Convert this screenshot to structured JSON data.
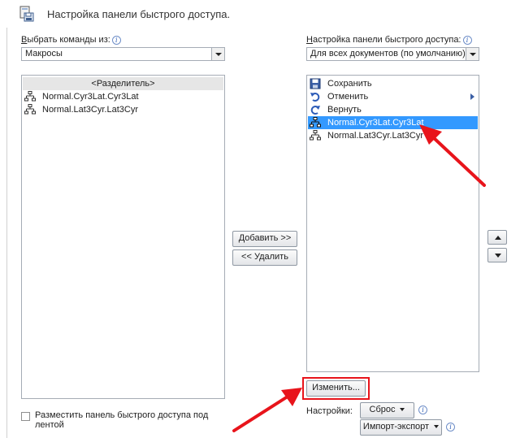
{
  "header": {
    "title": "Настройка панели быстрого доступа."
  },
  "left": {
    "choose_label_ul": "В",
    "choose_label_rest": "ыбрать команды из:",
    "commands_combo_value": "Макросы",
    "items": [
      {
        "label": "<Разделитель>",
        "kind": "separator"
      },
      {
        "label": "Normal.Cyr3Lat.Cyr3Lat",
        "icon": "macro-icon"
      },
      {
        "label": "Normal.Lat3Cyr.Lat3Cyr",
        "icon": "macro-icon"
      }
    ],
    "place_below_checkbox_label_line1": "Разместить панель быстрого доступа под",
    "place_below_checkbox_label_line2": "лентой"
  },
  "middle": {
    "add_button": "Добавить >>",
    "remove_button": "<< Удалить"
  },
  "right": {
    "customize_label_ul": "Н",
    "customize_label_rest": "астройка панели быстрого доступа:",
    "scope_combo_value": "Для всех документов (по умолчанию)",
    "items": [
      {
        "label": "Сохранить",
        "icon": "save-icon"
      },
      {
        "label": "Отменить",
        "icon": "undo-icon"
      },
      {
        "label": "Вернуть",
        "icon": "redo-icon"
      },
      {
        "label": "Normal.Cyr3Lat.Cyr3Lat",
        "icon": "macro-icon",
        "selected": true
      },
      {
        "label": "Normal.Lat3Cyr.Lat3Cyr",
        "icon": "macro-icon"
      }
    ],
    "modify_button": "Изменить...",
    "settings_label": "Настройки:",
    "reset_button": "Сброс",
    "import_export_button": "Импорт-экспорт"
  },
  "colors": {
    "selection": "#3399ff",
    "annotation_red": "#e8141b",
    "separator_bg": "#e6e6e6"
  }
}
